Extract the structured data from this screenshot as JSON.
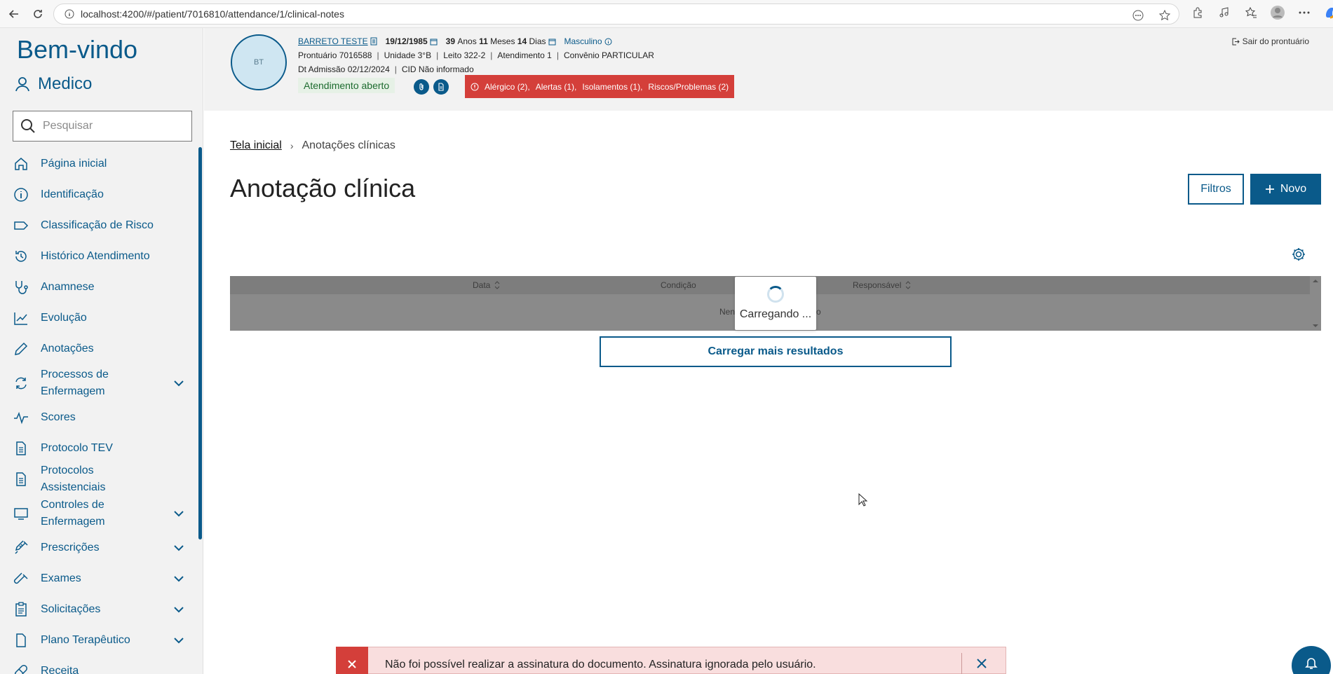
{
  "browser": {
    "url": "localhost:4200/#/patient/7016810/attendance/1/clinical-notes"
  },
  "sidebar": {
    "welcome": "Bem-vindo",
    "role": "Medico",
    "search_placeholder": "Pesquisar",
    "items": [
      {
        "label": "Página inicial",
        "icon": "home-icon",
        "expandable": false
      },
      {
        "label": "Identificação",
        "icon": "info-icon",
        "expandable": false
      },
      {
        "label": "Classificação de Risco",
        "icon": "tag-icon",
        "expandable": false
      },
      {
        "label": "Histórico Atendimento",
        "icon": "history-icon",
        "expandable": false
      },
      {
        "label": "Anamnese",
        "icon": "stethoscope-icon",
        "expandable": false
      },
      {
        "label": "Evolução",
        "icon": "chart-line-icon",
        "expandable": false
      },
      {
        "label": "Anotações",
        "icon": "pencil-icon",
        "expandable": false
      },
      {
        "label": "Processos de Enfermagem",
        "icon": "sync-icon",
        "expandable": true
      },
      {
        "label": "Scores",
        "icon": "pulse-icon",
        "expandable": false
      },
      {
        "label": "Protocolo TEV",
        "icon": "document-icon",
        "expandable": false
      },
      {
        "label": "Protocolos Assistenciais",
        "icon": "document-icon",
        "expandable": false
      },
      {
        "label": "Controles de Enfermagem",
        "icon": "monitor-icon",
        "expandable": true
      },
      {
        "label": "Prescrições",
        "icon": "syringe-icon",
        "expandable": true
      },
      {
        "label": "Exames",
        "icon": "test-tube-icon",
        "expandable": true
      },
      {
        "label": "Solicitações",
        "icon": "clipboard-icon",
        "expandable": true
      },
      {
        "label": "Plano Terapêutico",
        "icon": "file-icon",
        "expandable": true
      },
      {
        "label": "Receita",
        "icon": "pill-icon",
        "expandable": false
      }
    ]
  },
  "patient": {
    "initials": "BT",
    "name": "BARRETO TESTE",
    "birth_date": "19/12/1985",
    "age_years": "39",
    "age_years_unit": "Anos",
    "age_months": "11",
    "age_months_unit": "Meses",
    "age_days": "14",
    "age_days_unit": "Dias",
    "gender": "Masculino",
    "record_label": "Prontuário",
    "record_number": "7016588",
    "unit_label": "Unidade",
    "unit": "3°B",
    "bed_label": "Leito",
    "bed": "322-2",
    "attendance_label": "Atendimento",
    "attendance": "1",
    "insurance_label": "Convênio",
    "insurance": "PARTICULAR",
    "admission_label": "Dt Admissão",
    "admission_date": "02/12/2024",
    "cid_label": "CID",
    "cid": "Não informado",
    "status": "Atendimento aberto",
    "alerts": [
      "Alérgico (2),",
      "Alertas (1),",
      "Isolamentos (1),",
      "Riscos/Problemas (2)"
    ],
    "exit_label": "Sair do prontuário"
  },
  "main": {
    "breadcrumb_home": "Tela inicial",
    "breadcrumb_current": "Anotações clínicas",
    "title": "Anotação clínica",
    "filters_button": "Filtros",
    "new_button": "Novo",
    "columns": [
      "Data",
      "Condição",
      "Responsável"
    ],
    "empty_text_partial": "Nen",
    "empty_text_tail": "o",
    "loading_text": "Carregando ...",
    "load_more": "Carregar mais resultados"
  },
  "toast": {
    "message": "Não foi possível realizar a assinatura do documento. Assinatura ignorada pelo usuário."
  },
  "colors": {
    "primary": "#0a5a8a",
    "danger": "#d43f3a",
    "status_bg": "#e6f1e6"
  }
}
